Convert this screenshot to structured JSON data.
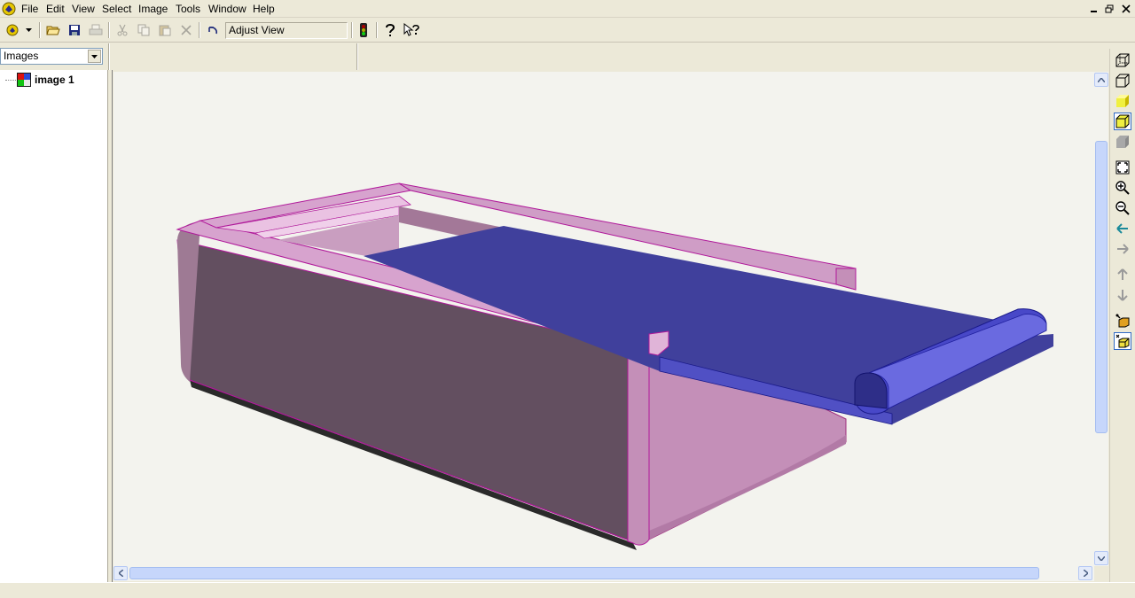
{
  "menu": {
    "items": [
      {
        "label": "File"
      },
      {
        "label": "Edit"
      },
      {
        "label": "View"
      },
      {
        "label": "Select"
      },
      {
        "label": "Image"
      },
      {
        "label": "Tools"
      },
      {
        "label": "Window"
      },
      {
        "label": "Help"
      }
    ]
  },
  "toolbar": {
    "view_mode_value": "Adjust View",
    "icons": [
      "app-dropdown-icon",
      "open-icon",
      "save-icon",
      "print-icon",
      "cut-icon",
      "copy-icon",
      "paste-icon",
      "delete-icon",
      "undo-icon",
      "traffic-light-icon",
      "help-icon",
      "context-help-icon"
    ]
  },
  "panel": {
    "selector_value": "Images",
    "tree": [
      {
        "label": "image 1"
      }
    ]
  },
  "right_tools": [
    "wireframe-icon",
    "hidden-line-icon",
    "shaded-face-icon",
    "shaded-edges-icon",
    "flat-shaded-icon",
    "fit-view-icon",
    "zoom-in-icon",
    "zoom-out-icon",
    "pan-left-icon",
    "pan-right-icon",
    "pan-up-icon",
    "pan-down-icon",
    "light-icon",
    "render-icon"
  ],
  "colors": {
    "box_pink": "#c48fb8",
    "box_dark": "#634f60",
    "edge_magenta": "#b0189a",
    "lid_blue": "#40409c",
    "viewport_bg": "#f3f3ee"
  }
}
